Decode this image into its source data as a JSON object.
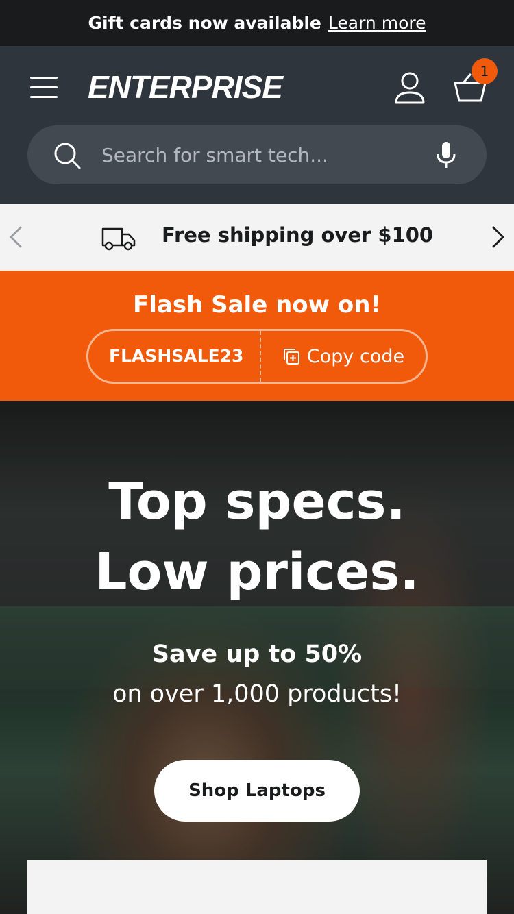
{
  "announcement": {
    "text": "Gift cards now available",
    "link": "Learn more"
  },
  "header": {
    "logo": "ENTERPRISE",
    "cart_count": "1",
    "icons": [
      "menu-icon",
      "user-icon",
      "cart-icon",
      "search-icon",
      "microphone-icon"
    ]
  },
  "search": {
    "placeholder": "Search for smart tech..."
  },
  "shipping": {
    "text": "Free shipping over $100",
    "icons": [
      "chevron-left-icon",
      "truck-icon",
      "chevron-right-icon"
    ]
  },
  "flash_sale": {
    "title": "Flash Sale now on!",
    "code": "FLASHSALE23",
    "copy_label": "Copy code"
  },
  "hero": {
    "headline_line1": "Top specs.",
    "headline_line2": "Low prices.",
    "sub_line1": "Save up to 50%",
    "sub_line2": "on over 1,000 products!",
    "cta": "Shop Laptops"
  },
  "colors": {
    "announcement_bg": "#1a1b1c",
    "header_bg": "#2f353d",
    "accent": "#f15a0b",
    "light_bg": "#f3f3f3"
  }
}
